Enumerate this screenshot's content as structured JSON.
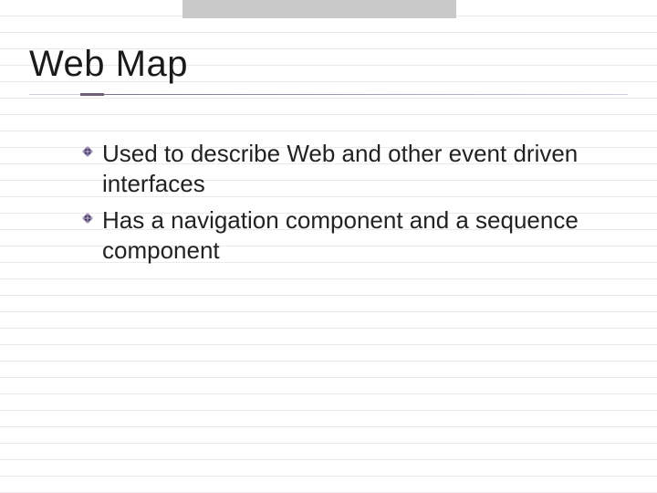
{
  "slide": {
    "title": "Web Map",
    "bullets": [
      "Used to describe Web and other event driven interfaces",
      "Has a navigation component and a sequence component"
    ]
  }
}
